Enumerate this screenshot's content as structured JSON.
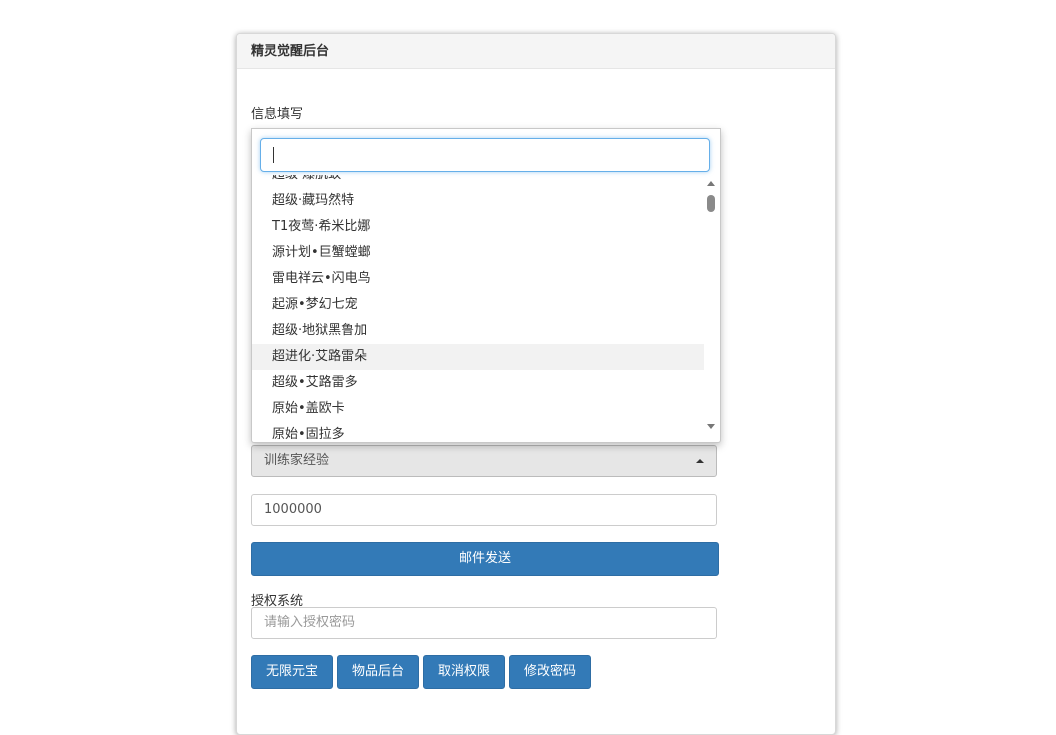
{
  "panel": {
    "title": "精灵觉醒后台"
  },
  "info_section": {
    "label": "信息填写"
  },
  "item_select": {
    "value": "训练家经验"
  },
  "amount_input": {
    "value": "1000000"
  },
  "send_button": {
    "label": "邮件发送"
  },
  "auth_section": {
    "label": "授权系统",
    "password_placeholder": "请输入授权密码"
  },
  "action_buttons": [
    "无限元宝",
    "物品后台",
    "取消权限",
    "修改密码"
  ],
  "dropdown": {
    "search_value": "",
    "options": [
      "超级·爆肌蚊",
      "超级·藏玛然特",
      "T1夜莺·希米比娜",
      "源计划•巨蟹螳螂",
      "雷电祥云•闪电鸟",
      "起源•梦幻七宠",
      "超级·地狱黑鲁加",
      "超进化·艾路雷朵",
      "超级•艾路雷多",
      "原始•盖欧卡",
      "原始•固拉多"
    ],
    "highlighted": "超进化·艾路雷朵"
  },
  "colors": {
    "primary": "#337ab7",
    "focus": "#66afe9",
    "danger": "#c9302c"
  }
}
